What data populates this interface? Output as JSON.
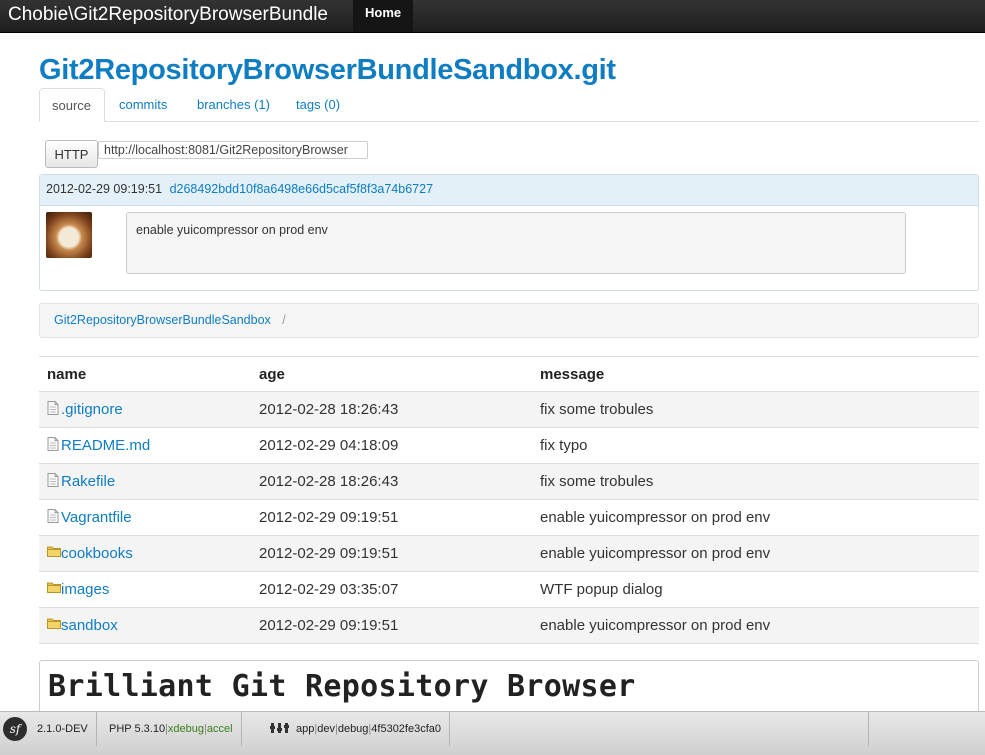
{
  "navbar": {
    "brand": "Chobie\\Git2RepositoryBrowserBundle",
    "home_label": "Home"
  },
  "repo": {
    "title": "Git2RepositoryBrowserBundleSandbox.git"
  },
  "tabs": [
    {
      "label": "source",
      "active": true
    },
    {
      "label": "commits",
      "active": false
    },
    {
      "label": "branches (1)",
      "active": false
    },
    {
      "label": "tags (0)",
      "active": false
    }
  ],
  "clone": {
    "protocol_label": "HTTP",
    "url": "http://localhost:8081/Git2RepositoryBrowser"
  },
  "commit": {
    "date": "2012-02-29 09:19:51",
    "hash": "d268492bdd10f8a6498e66d5caf5f8f3a74b6727",
    "message": "enable yuicompressor on prod env"
  },
  "breadcrumb": {
    "root": "Git2RepositoryBrowserBundleSandbox",
    "separator": "/"
  },
  "files": {
    "headers": {
      "name": "name",
      "age": "age",
      "message": "message"
    },
    "rows": [
      {
        "type": "file",
        "name": ".gitignore",
        "age": "2012-02-28 18:26:43",
        "message": "fix some trobules"
      },
      {
        "type": "file",
        "name": "README.md",
        "age": "2012-02-29 04:18:09",
        "message": "fix typo"
      },
      {
        "type": "file",
        "name": "Rakefile",
        "age": "2012-02-28 18:26:43",
        "message": "fix some trobules"
      },
      {
        "type": "file",
        "name": "Vagrantfile",
        "age": "2012-02-29 09:19:51",
        "message": "enable yuicompressor on prod env"
      },
      {
        "type": "folder",
        "name": "cookbooks",
        "age": "2012-02-29 09:19:51",
        "message": "enable yuicompressor on prod env"
      },
      {
        "type": "folder",
        "name": "images",
        "age": "2012-02-29 03:35:07",
        "message": "WTF popup dialog"
      },
      {
        "type": "folder",
        "name": "sandbox",
        "age": "2012-02-29 09:19:51",
        "message": "enable yuicompressor on prod env"
      }
    ]
  },
  "readme": {
    "title": "Brilliant Git Repository Browser"
  },
  "debug_toolbar": {
    "logo": "sf",
    "version": "2.1.0-DEV",
    "php_label": "PHP 5.3.10",
    "php_ext1": "xdebug",
    "php_ext2": "accel",
    "sep": "|",
    "app": "app",
    "env": "dev",
    "debug": "debug",
    "token": "4f5302fe3cfa0"
  },
  "colors": {
    "link": "#0f7dc2",
    "navbar": "#222222",
    "commit_header": "#e3f0f7",
    "folder_icon": "#e8c44a"
  }
}
